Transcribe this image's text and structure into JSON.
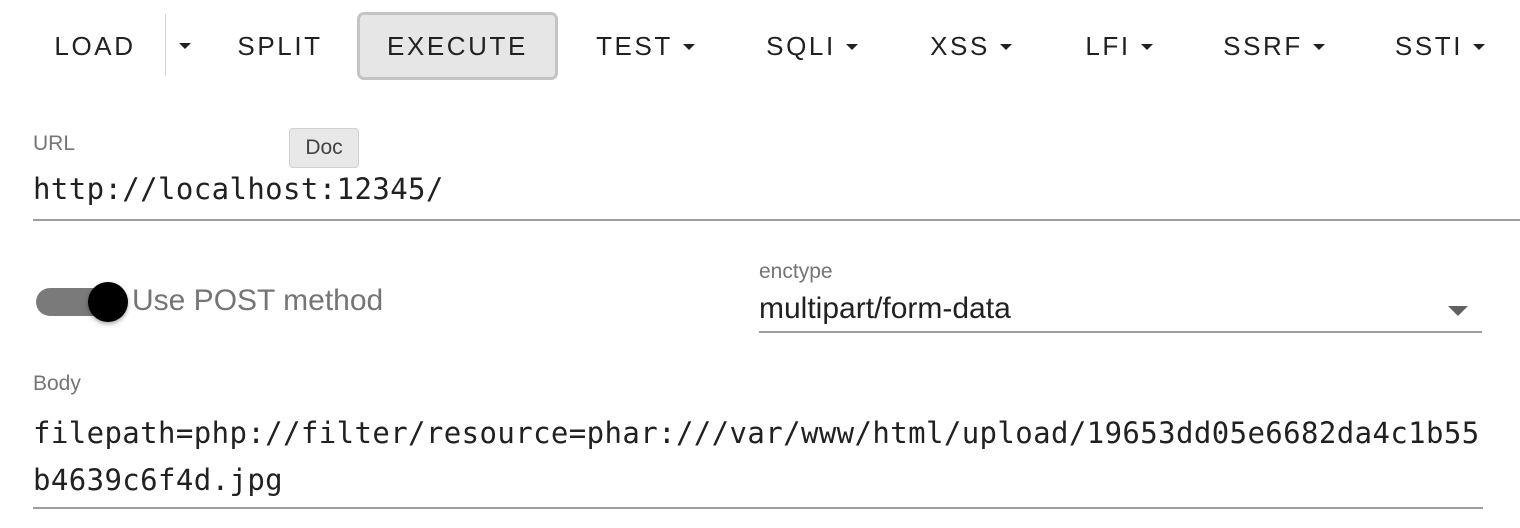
{
  "toolbar": {
    "load": "LOAD",
    "split": "SPLIT",
    "execute": "EXECUTE",
    "test": "TEST",
    "sqli": "SQLI",
    "xss": "XSS",
    "lfi": "LFI",
    "ssrf": "SSRF",
    "ssti": "SSTI"
  },
  "url_field": {
    "label": "URL",
    "value": "http://localhost:12345/"
  },
  "tooltip": "Doc",
  "post_toggle": {
    "label": "Use POST method",
    "enabled": true
  },
  "enctype": {
    "label": "enctype",
    "value": "multipart/form-data"
  },
  "body_field": {
    "label": "Body",
    "value": "filepath=php://filter/resource=phar:///var/www/html/upload/19653dd05e6682da4c1b55b4639c6f4d.jpg"
  },
  "icons": {
    "dropdown": "chevron-down-icon"
  }
}
